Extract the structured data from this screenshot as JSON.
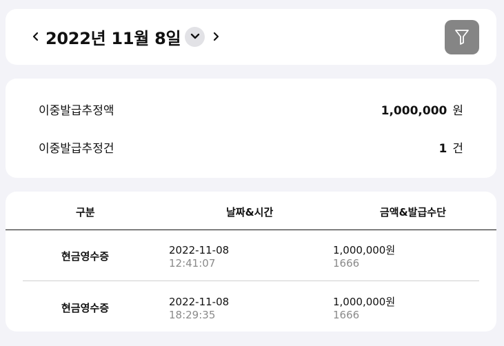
{
  "header": {
    "date_title": "2022년 11월 8일",
    "prev_icon": "chevron-left-icon",
    "next_icon": "chevron-right-icon",
    "dropdown_icon": "chevron-down-icon",
    "filter_icon": "filter-icon"
  },
  "summary": {
    "rows": [
      {
        "label": "이중발급추정액",
        "value": "1,000,000",
        "unit": "원"
      },
      {
        "label": "이중발급추정건",
        "value": "1",
        "unit": "건"
      }
    ]
  },
  "table": {
    "headers": [
      "구분",
      "날짜&시간",
      "금액&발급수단"
    ],
    "rows": [
      {
        "type": "현금영수증",
        "date": "2022-11-08",
        "time": "12:41:07",
        "amount": "1,000,000원",
        "method": "1666"
      },
      {
        "type": "현금영수증",
        "date": "2022-11-08",
        "time": "18:29:35",
        "amount": "1,000,000원",
        "method": "1666"
      }
    ]
  },
  "colors": {
    "background": "#f3f3f8",
    "card": "#ffffff",
    "filter_button": "#858585",
    "dropdown_button": "#e2e2e6",
    "secondary_text": "#8a8a8a"
  }
}
